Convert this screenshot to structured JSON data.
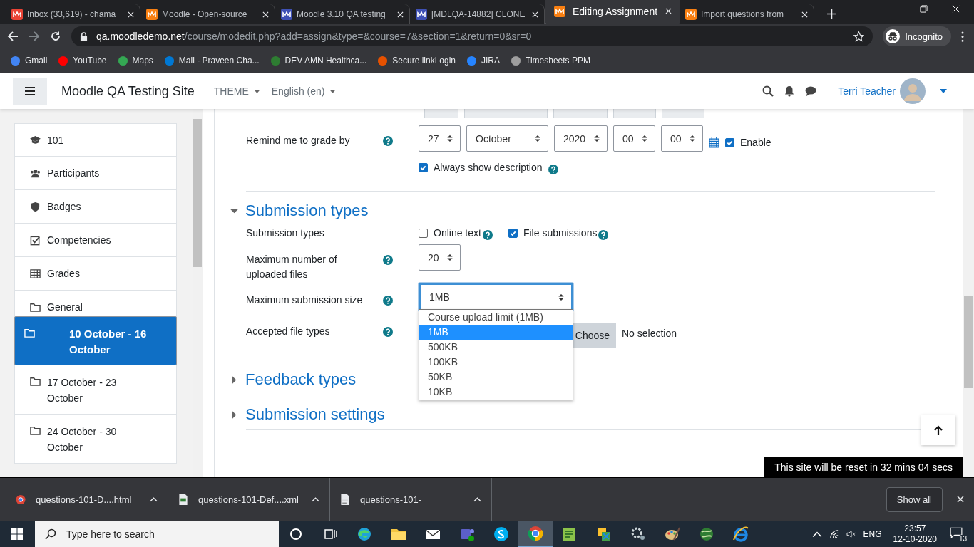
{
  "browser": {
    "tabs": [
      {
        "title": "Inbox (33,619) - chama",
        "kind": "mail",
        "selected": false
      },
      {
        "title": "Moodle - Open-source",
        "kind": "moodle",
        "selected": false
      },
      {
        "title": "Moodle 3.10 QA testing",
        "kind": "tracker",
        "selected": false
      },
      {
        "title": "[MDLQA-14882] CLONE",
        "kind": "tracker",
        "selected": false
      },
      {
        "title": "Editing Assignment",
        "kind": "moodle",
        "selected": true
      },
      {
        "title": "Import questions from",
        "kind": "moodle",
        "selected": false
      }
    ],
    "address": {
      "domain": "qa.moodledemo.net",
      "path": "/course/modedit.php?add=assign&type=&course=7&section=1&return=0&sr=0"
    },
    "profile": "Incognito",
    "bookmarks": [
      {
        "label": "Gmail",
        "kind": "google"
      },
      {
        "label": "YouTube",
        "kind": "video"
      },
      {
        "label": "Maps",
        "kind": "map"
      },
      {
        "label": "Mail - Praveen Cha...",
        "kind": "mail"
      },
      {
        "label": "DEV AMN Healthca...",
        "kind": "leaf"
      },
      {
        "label": "Secure linkLogin",
        "kind": "swirl"
      },
      {
        "label": "JIRA",
        "kind": "diamond"
      },
      {
        "label": "Timesheets PPM",
        "kind": "moon"
      }
    ]
  },
  "moodle": {
    "site_name": "Moodle QA Testing Site",
    "menus": [
      "THEME",
      "English (en)"
    ],
    "user_name": "Terri Teacher"
  },
  "sidebar": {
    "items": [
      {
        "label": "101",
        "kind": "course",
        "selected": false
      },
      {
        "label": "Participants",
        "kind": "participants",
        "selected": false
      },
      {
        "label": "Badges",
        "kind": "badges",
        "selected": false
      },
      {
        "label": "Competencies",
        "kind": "competencies",
        "selected": false
      },
      {
        "label": "Grades",
        "kind": "grades",
        "selected": false
      },
      {
        "label": "General",
        "kind": "section",
        "selected": false
      },
      {
        "label": "10 October - 16 October",
        "kind": "section",
        "selected": true
      },
      {
        "label": "17 October - 23 October",
        "kind": "section",
        "selected": false
      },
      {
        "label": "24 October - 30 October",
        "kind": "section",
        "selected": false
      }
    ]
  },
  "form": {
    "remind": {
      "label": "Remind me to grade by",
      "selects": [
        "27",
        "October",
        "2020",
        "00",
        "00"
      ],
      "enable": {
        "label": "Enable",
        "checked": true
      }
    },
    "always_show_description": {
      "label": "Always show description",
      "checked": true
    },
    "sections": [
      {
        "title": "Submission types",
        "expanded": true
      },
      {
        "title": "Feedback types",
        "expanded": false
      },
      {
        "title": "Submission settings",
        "expanded": false
      }
    ],
    "submission_types": {
      "label": "Submission types",
      "options": [
        {
          "label": "Online text",
          "checked": false
        },
        {
          "label": "File submissions",
          "checked": true
        }
      ]
    },
    "max_files": {
      "label": "Maximum number of uploaded files",
      "value": "20"
    },
    "max_size": {
      "label": "Maximum submission size",
      "value": "1MB",
      "focused": true,
      "open": true,
      "options": [
        {
          "label": "Course upload limit (1MB)",
          "selected": false
        },
        {
          "label": "1MB",
          "selected": true
        },
        {
          "label": "500KB",
          "selected": false
        },
        {
          "label": "100KB",
          "selected": false
        },
        {
          "label": "50KB",
          "selected": false
        },
        {
          "label": "10KB",
          "selected": false
        }
      ]
    },
    "file_types": {
      "label": "Accepted file types",
      "button": "Choose",
      "value": "No selection"
    }
  },
  "reset_notice": "This site will be reset in 32 mins 04 secs",
  "downloads": {
    "items": [
      {
        "name": "questions-101-D....html",
        "kind": "html"
      },
      {
        "name": "questions-101-Def....xml",
        "kind": "xml"
      },
      {
        "name": "questions-101-",
        "kind": "file"
      }
    ],
    "show_all": "Show all"
  },
  "taskbar": {
    "search_placeholder": "Type here to search",
    "language": "ENG",
    "time": "23:57",
    "date": "12-10-2020",
    "notifications": "13"
  }
}
